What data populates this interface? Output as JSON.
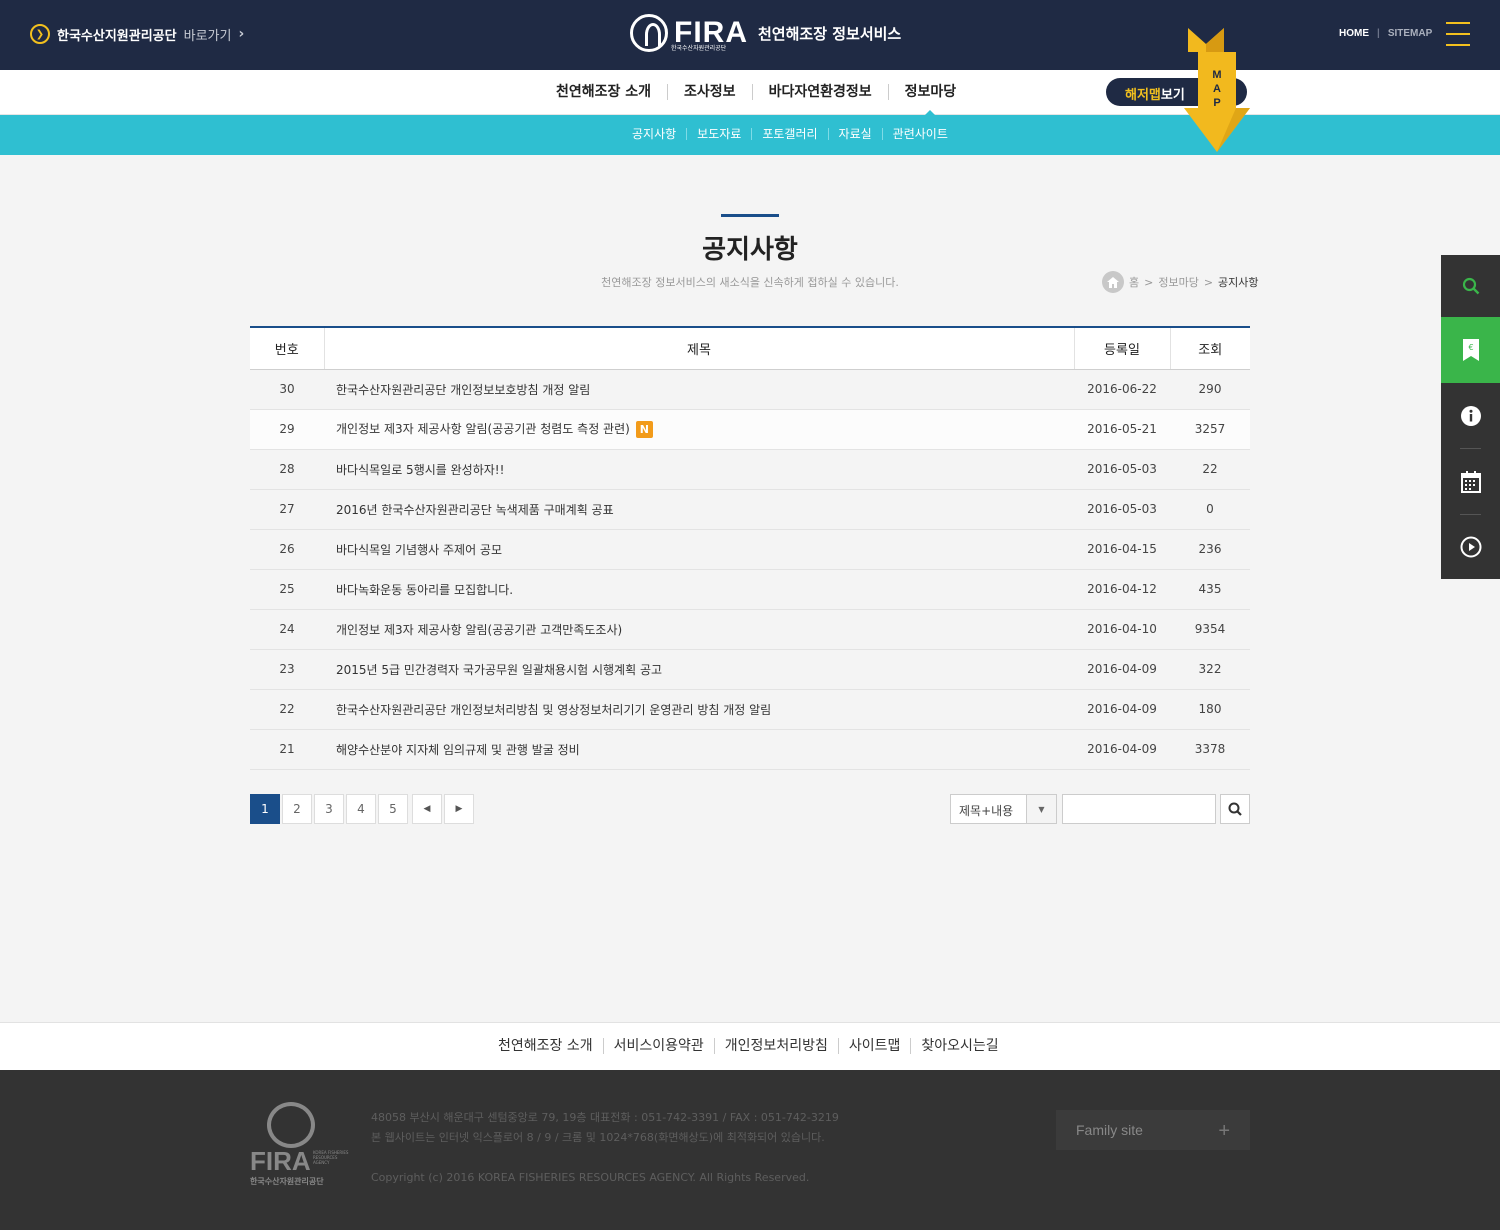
{
  "header": {
    "shortcut_label": "한국수산지원관리공단",
    "shortcut_go": "바로가기",
    "logo_text": "FIRA",
    "logo_sub": "한국수산자원관리공단",
    "service_name": "천연해조장 정보서비스",
    "home": "HOME",
    "sitemap": "SITEMAP"
  },
  "gnb": {
    "items": [
      {
        "label": "천연해조장 소개"
      },
      {
        "label": "조사정보"
      },
      {
        "label": "바다자연환경정보"
      },
      {
        "label": "정보마당"
      }
    ],
    "map_button_highlight": "해저맵",
    "map_button_rest": "보기",
    "map_tag": [
      "M",
      "A",
      "P"
    ]
  },
  "subnav": {
    "items": [
      {
        "label": "공지사항"
      },
      {
        "label": "보도자료"
      },
      {
        "label": "포토갤러리"
      },
      {
        "label": "자료실"
      },
      {
        "label": "관련사이트"
      }
    ]
  },
  "page": {
    "title": "공지사항",
    "description": "천연해조장 정보서비스의 새소식을 신속하게 접하실 수 있습니다.",
    "breadcrumb": [
      "홈",
      "정보마당",
      "공지사항"
    ]
  },
  "table": {
    "headers": {
      "no": "번호",
      "subject": "제목",
      "date": "등록일",
      "views": "조회"
    },
    "new_badge": "N",
    "rows": [
      {
        "no": "30",
        "subject": "한국수산자원관리공단 개인정보보호방침 개정 알림",
        "date": "2016-06-22",
        "views": "290"
      },
      {
        "no": "29",
        "subject": "개인정보 제3자 제공사항 알림(공공기관 청렴도 측정 관련)",
        "date": "2016-05-21",
        "views": "3257"
      },
      {
        "no": "28",
        "subject": "바다식목일로 5행시를 완성하자!!",
        "date": "2016-05-03",
        "views": "22"
      },
      {
        "no": "27",
        "subject": "2016년 한국수산자원관리공단 녹색제품 구매계획 공표",
        "date": "2016-05-03",
        "views": "0"
      },
      {
        "no": "26",
        "subject": "바다식목일 기념행사 주제어 공모",
        "date": "2016-04-15",
        "views": "236"
      },
      {
        "no": "25",
        "subject": "바다녹화운동 동아리를 모집합니다.",
        "date": "2016-04-12",
        "views": "435"
      },
      {
        "no": "24",
        "subject": "개인정보 제3자 제공사항 알림(공공기관 고객만족도조사)",
        "date": "2016-04-10",
        "views": "9354"
      },
      {
        "no": "23",
        "subject": "2015년 5급 민간경력자 국가공무원 일괄채용시험 시행계획 공고",
        "date": "2016-04-09",
        "views": "322"
      },
      {
        "no": "22",
        "subject": "한국수산자원관리공단 개인정보처리방침 및 영상정보처리기기 운영관리 방침 개정 알림",
        "date": "2016-04-09",
        "views": "180"
      },
      {
        "no": "21",
        "subject": "해양수산분야 지자체 임의규제 및 관행 발굴 정비",
        "date": "2016-04-09",
        "views": "3378"
      }
    ]
  },
  "pagination": {
    "pages": [
      "1",
      "2",
      "3",
      "4",
      "5"
    ],
    "current": "1"
  },
  "search": {
    "option": "제목+내용",
    "input_value": ""
  },
  "footer_nav": {
    "items": [
      {
        "label": "천연해조장 소개"
      },
      {
        "label": "서비스이용약관"
      },
      {
        "label": "개인정보처리방침"
      },
      {
        "label": "사이트맵"
      },
      {
        "label": "찾아오시는길"
      }
    ]
  },
  "footer": {
    "logo_text": "FIRA",
    "logo_en": "KOREA FISHERIES RESOURCES AGENCY",
    "logo_ko": "한국수산자원관리공단",
    "address": "48058  부산시 해운대구 센텀중앙로 79, 19층  대표전화 : 051-742-3391 / FAX : 051-742-3219",
    "browser_note": "본 웹사이트는 인터넷 익스플로어 8 / 9 / 크롬 및 1024*768(화면해상도)에 최적화되어 있습니다.",
    "copyright": "Copyright (c) 2016 KOREA FISHERIES RESOURCES AGENCY. All Rights Reserved.",
    "family_site": "Family site"
  },
  "colors": {
    "navy": "#1f2a44",
    "accent_yellow": "#f2c01e",
    "cyan": "#2fbfd1",
    "blue": "#1a4e8a",
    "green": "#3ab54a",
    "new_badge": "#f29b1a"
  },
  "icons": {
    "quick_menu": [
      "search-icon",
      "document-icon",
      "info-icon",
      "calendar-icon",
      "play-icon"
    ]
  }
}
